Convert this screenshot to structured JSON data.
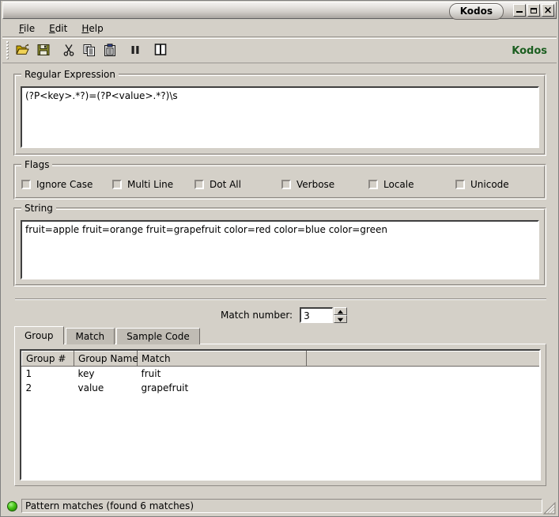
{
  "window": {
    "title": "Kodos",
    "buttons": [
      {
        "name": "minimize",
        "glyph": "minimize-icon"
      },
      {
        "name": "maximize",
        "glyph": "maximize-icon"
      },
      {
        "name": "close",
        "glyph": "close-icon"
      }
    ]
  },
  "menubar": {
    "items": [
      {
        "accel": "F",
        "rest": "ile",
        "label": "File"
      },
      {
        "accel": "E",
        "rest": "dit",
        "label": "Edit"
      },
      {
        "accel": "H",
        "rest": "elp",
        "label": "Help"
      }
    ]
  },
  "toolbar": {
    "buttons": [
      {
        "name": "open-icon",
        "label": "Open"
      },
      {
        "name": "save-icon",
        "label": "Save"
      },
      {
        "name": "cut-icon",
        "label": "Cut"
      },
      {
        "name": "copy-icon",
        "label": "Copy"
      },
      {
        "name": "paste-icon",
        "label": "Paste"
      },
      {
        "name": "pause-icon",
        "label": "Pause"
      },
      {
        "name": "book-icon",
        "label": "Reference"
      }
    ],
    "brand": "Kodos"
  },
  "regex_group": {
    "title": "Regular Expression",
    "value": "(?P<key>.*?)=(?P<value>.*?)\\s"
  },
  "flags_group": {
    "title": "Flags",
    "items": [
      {
        "label": "Ignore Case",
        "checked": false
      },
      {
        "label": "Multi Line",
        "checked": false
      },
      {
        "label": "Dot All",
        "checked": false
      },
      {
        "label": "Verbose",
        "checked": false
      },
      {
        "label": "Locale",
        "checked": false
      },
      {
        "label": "Unicode",
        "checked": false
      }
    ]
  },
  "string_group": {
    "title": "String",
    "value": "fruit=apple fruit=orange fruit=grapefruit color=red color=blue color=green"
  },
  "match_number": {
    "label": "Match number:",
    "value": "3",
    "up_glyph": "spinner-up-icon",
    "down_glyph": "spinner-down-icon"
  },
  "tabs": [
    {
      "label": "Group",
      "active": true
    },
    {
      "label": "Match",
      "active": false
    },
    {
      "label": "Sample Code",
      "active": false
    }
  ],
  "group_table": {
    "columns": [
      "Group #",
      "Group Name",
      "Match"
    ],
    "rows": [
      [
        "1",
        "key",
        "fruit"
      ],
      [
        "2",
        "value",
        "grapefruit"
      ]
    ]
  },
  "statusbar": {
    "indicator": "ok-led-icon",
    "text": "Pattern matches (found 6 matches)"
  },
  "colors": {
    "face": "#d4d0c8",
    "brand_green": "#1b5e20",
    "led_green": "#45c414",
    "field_white": "#ffffff"
  }
}
